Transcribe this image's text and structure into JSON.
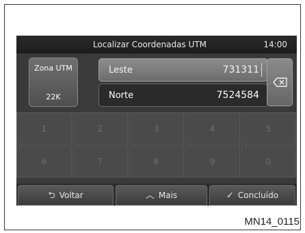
{
  "header": {
    "title": "Localizar Coordenadas UTM",
    "clock": "14:00"
  },
  "zone": {
    "label": "Zona UTM",
    "value": "22K"
  },
  "fields": [
    {
      "label": "Leste",
      "value": "731311"
    },
    {
      "label": "Norte",
      "value": "7524584"
    }
  ],
  "keypad": [
    "1",
    "2",
    "3",
    "4",
    "5",
    "6",
    "7",
    "8",
    "9",
    "0"
  ],
  "footer": {
    "back": {
      "label": "Voltar",
      "icon": "back-arrow-icon"
    },
    "more": {
      "label": "Mais",
      "icon": "chevron-up-icon"
    },
    "done": {
      "label": "Concluído",
      "icon": "check-icon"
    }
  },
  "reference": "MN14_0115",
  "colors": {
    "screen_bg": "#3a3a3a",
    "key_text_disabled": "#6f6f6f"
  }
}
